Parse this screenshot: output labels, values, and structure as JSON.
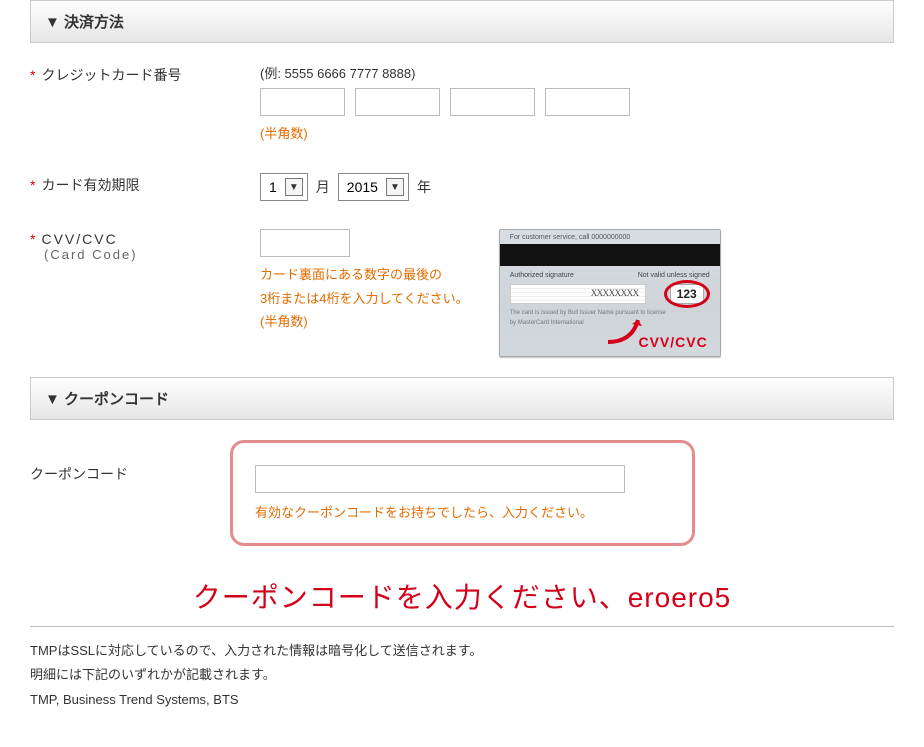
{
  "sections": {
    "payment_header": "▼ 決済方法",
    "coupon_header": "▼ クーポンコード"
  },
  "cc": {
    "label": "クレジットカード番号",
    "example": "(例: 5555 6666 7777 8888)",
    "hint": "(半角数)"
  },
  "exp": {
    "label": "カード有効期限",
    "month_value": "1",
    "month_unit": "月",
    "year_value": "2015",
    "year_unit": "年"
  },
  "cvv": {
    "label": "CVV/CVC",
    "sublabel": "(Card Code)",
    "hint_line1": "カード裏面にある数字の最後の",
    "hint_line2": "3桁または4桁を入力してください。",
    "hint_line3": "(半角数)",
    "illust_number": "123",
    "illust_label": "CVV/CVC"
  },
  "coupon": {
    "label": "クーポンコード",
    "hint": "有効なクーポンコードをお持ちでしたら、入力ください。"
  },
  "instruction": "クーポンコードを入力ください、eroero5",
  "footer": {
    "line1": "TMPはSSLに対応しているので、入力された情報は暗号化して送信されます。",
    "line2": "明細には下記のいずれかが記載されます。",
    "line3": "TMP, Business Trend Systems, BTS"
  }
}
